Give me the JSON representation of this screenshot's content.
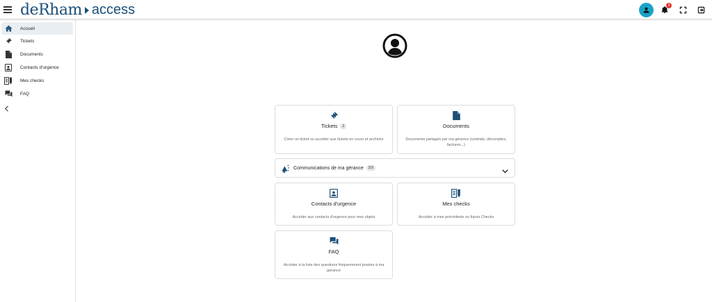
{
  "header": {
    "logo_main": "deRham",
    "logo_sub": "access",
    "notification_count": "2"
  },
  "sidebar": {
    "items": [
      {
        "label": "Accueil",
        "icon": "home-icon",
        "active": true
      },
      {
        "label": "Tickets",
        "icon": "ticket-icon"
      },
      {
        "label": "Documents",
        "icon": "document-icon"
      },
      {
        "label": "Contacts d'urgence",
        "icon": "contact-card-icon"
      },
      {
        "label": "Mes checks",
        "icon": "checklist-icon"
      },
      {
        "label": "FAQ",
        "icon": "chat-bubbles-icon"
      }
    ]
  },
  "cards": {
    "tickets": {
      "title": "Tickets",
      "badge": "2",
      "description": "Créer un ticket ou accéder aux tickets en cours et archivés"
    },
    "documents": {
      "title": "Documents",
      "description": "Documents partagés par ma gérance (contrats, décomptes, factures...)"
    },
    "communications": {
      "title": "Communications de ma gérance",
      "badge": "2/3"
    },
    "contacts": {
      "title": "Contacts d'urgence",
      "description": "Accéder aux contacts d'urgence pour mes objets"
    },
    "checks": {
      "title": "Mes checks",
      "description": "Accéder à mes précédents ou futurs Checks"
    },
    "faq": {
      "title": "FAQ",
      "description": "Accéder à la liste des questions fréquemment posées à ma gérance"
    }
  },
  "colors": {
    "brand": "#1c4f78",
    "accent": "#1aa3c9",
    "badge_red": "#e53935"
  }
}
